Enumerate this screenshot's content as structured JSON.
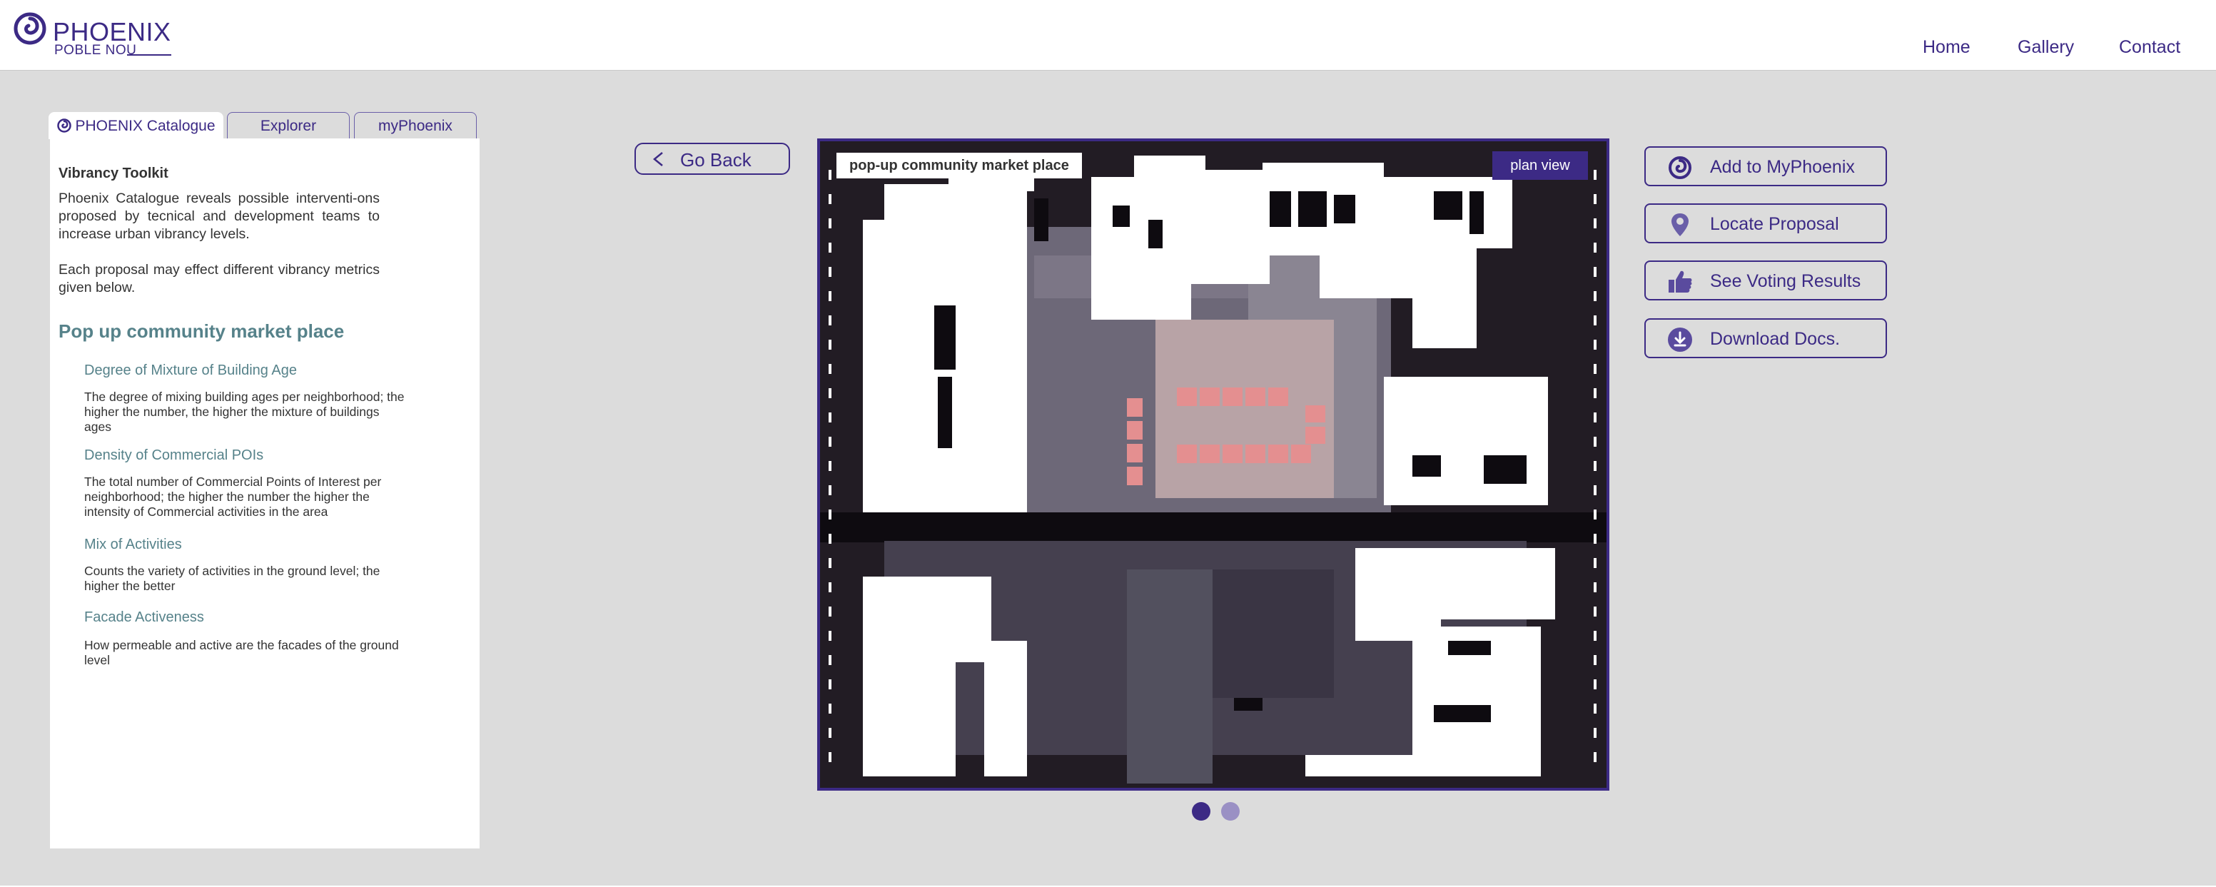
{
  "header": {
    "logo_title": "PHOENIX",
    "logo_subtitle": "POBLE NOU",
    "nav": [
      "Home",
      "Gallery",
      "Contact"
    ]
  },
  "tabs": [
    "PHOENIX Catalogue",
    "Explorer",
    "myPhoenix"
  ],
  "panel": {
    "toolkit_title": "Vibrancy Toolkit",
    "intro_1": "Phoenix Catalogue reveals possible interventi-ons proposed by tecnical and development teams to increase urban vibrancy levels.",
    "intro_2": "Each proposal may effect different vibrancy metrics given below.",
    "proposal_title": "Pop up community market place",
    "metrics": [
      {
        "name": "Degree of Mixture of Building Age",
        "desc": "The degree of mixing building ages per neighborhood; the higher the number, the higher the mixture of buildings ages"
      },
      {
        "name": "Density of Commercial POIs",
        "desc": "The total number of Commercial Points of Interest per neighborhood; the higher the number the higher the intensity of Commercial activities in the area"
      },
      {
        "name": "Mix of Activities",
        "desc": "Counts the variety of activities in the ground level; the higher the better"
      },
      {
        "name": "Facade Activeness",
        "desc": "How permeable and active are the facades of the ground level"
      }
    ]
  },
  "go_back": "Go Back",
  "viewer": {
    "label": "pop-up community market place",
    "plan_button": "plan view",
    "active_slide": 1,
    "slide_count": 2
  },
  "actions": [
    {
      "label": "Add to MyPhoenix",
      "icon": "phoenix-swirl-icon"
    },
    {
      "label": "Locate Proposal",
      "icon": "map-pin-icon"
    },
    {
      "label": "See Voting Results",
      "icon": "thumbs-up-icon"
    },
    {
      "label": "Download Docs.",
      "icon": "download-icon"
    }
  ],
  "colors": {
    "brand": "#3c2a85",
    "teal_heading": "#56828a",
    "background": "#dcdcdc",
    "dot_active": "#3c2a85",
    "dot_inactive": "#9a90c4"
  }
}
